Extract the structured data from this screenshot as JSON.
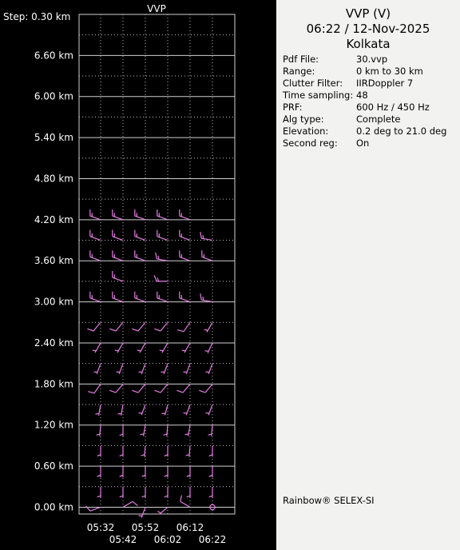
{
  "chart_data": {
    "type": "wind-barb-profile",
    "title": "VVP",
    "y_axis": {
      "step_label": "Step: 0.30 km",
      "tick_labels": [
        "0.00 km",
        "0.60 km",
        "1.20 km",
        "1.80 km",
        "2.40 km",
        "3.00 km",
        "3.60 km",
        "4.20 km",
        "4.80 km",
        "5.40 km",
        "6.00 km",
        "6.60 km"
      ],
      "ylim_km": [
        -0.1,
        7.2
      ],
      "major_tick_km": [
        0.0,
        0.6,
        1.2,
        1.8,
        2.4,
        3.0,
        3.6,
        4.2,
        4.8,
        5.4,
        6.0,
        6.6
      ],
      "minor_tick_km": [
        0.3,
        0.9,
        1.5,
        2.1,
        2.7,
        3.3,
        3.9,
        4.5,
        5.1,
        5.7,
        6.3,
        6.9
      ]
    },
    "x_axis": {
      "tick_labels_row1": [
        "05:32",
        "05:52",
        "06:12"
      ],
      "tick_labels_row2": [
        "05:42",
        "06:02",
        "06:22"
      ],
      "times": [
        "05:32",
        "05:42",
        "05:52",
        "06:02",
        "06:12",
        "06:22"
      ],
      "grid": true
    },
    "heights_km": [
      0.0,
      0.3,
      0.6,
      0.9,
      1.2,
      1.5,
      1.8,
      2.1,
      2.4,
      2.7,
      3.0,
      3.3,
      3.6,
      3.9,
      4.2
    ],
    "barb_color": "#e57ee5",
    "series": [
      {
        "time": "05:32",
        "barbs": [
          [
            250,
            10
          ],
          [
            180,
            5
          ],
          [
            180,
            5
          ],
          [
            180,
            5
          ],
          [
            185,
            5
          ],
          [
            190,
            5
          ],
          [
            215,
            10
          ],
          [
            200,
            5
          ],
          [
            210,
            5
          ],
          [
            220,
            10
          ],
          [
            290,
            15
          ],
          null,
          [
            290,
            15
          ],
          [
            290,
            15
          ],
          [
            290,
            15
          ]
        ]
      },
      {
        "time": "05:42",
        "barbs": [
          [
            60,
            10
          ],
          [
            180,
            5
          ],
          [
            180,
            5
          ],
          [
            180,
            5
          ],
          [
            180,
            5
          ],
          [
            190,
            5
          ],
          [
            220,
            10
          ],
          [
            200,
            5
          ],
          [
            210,
            5
          ],
          [
            220,
            10
          ],
          [
            290,
            15
          ],
          [
            290,
            15
          ],
          [
            290,
            15
          ],
          [
            290,
            15
          ],
          [
            290,
            15
          ]
        ]
      },
      {
        "time": "05:52",
        "barbs": [
          [
            200,
            5
          ],
          [
            180,
            5
          ],
          [
            180,
            5
          ],
          [
            185,
            5
          ],
          [
            190,
            5
          ],
          [
            200,
            5
          ],
          [
            220,
            10
          ],
          [
            200,
            5
          ],
          [
            210,
            5
          ],
          [
            220,
            10
          ],
          [
            290,
            15
          ],
          null,
          [
            290,
            15
          ],
          [
            290,
            15
          ],
          [
            290,
            15
          ]
        ]
      },
      {
        "time": "06:02",
        "barbs": [
          [
            230,
            5
          ],
          [
            180,
            5
          ],
          [
            180,
            5
          ],
          [
            180,
            5
          ],
          [
            185,
            5
          ],
          [
            195,
            5
          ],
          [
            220,
            10
          ],
          [
            200,
            5
          ],
          [
            210,
            5
          ],
          [
            220,
            10
          ],
          [
            290,
            15
          ],
          [
            270,
            15
          ],
          [
            280,
            15
          ],
          [
            290,
            15
          ],
          [
            290,
            15
          ]
        ]
      },
      {
        "time": "06:12",
        "barbs": [
          [
            300,
            10
          ],
          [
            180,
            5
          ],
          [
            180,
            5
          ],
          [
            185,
            5
          ],
          [
            190,
            5
          ],
          [
            200,
            5
          ],
          [
            220,
            10
          ],
          [
            200,
            5
          ],
          [
            210,
            5
          ],
          [
            215,
            10
          ],
          [
            290,
            15
          ],
          null,
          [
            290,
            15
          ],
          [
            290,
            15
          ],
          [
            290,
            15
          ]
        ]
      },
      {
        "time": "06:22",
        "barbs": [
          "calm",
          [
            180,
            5
          ],
          [
            180,
            5
          ],
          [
            180,
            5
          ],
          [
            185,
            5
          ],
          [
            200,
            5
          ],
          [
            220,
            10
          ],
          [
            200,
            5
          ],
          [
            205,
            5
          ],
          [
            210,
            5
          ],
          [
            280,
            15
          ],
          null,
          [
            290,
            15
          ],
          [
            280,
            15
          ],
          null
        ]
      }
    ]
  },
  "panel": {
    "title": "VVP (V)",
    "datetime": "06:22 / 12-Nov-2025",
    "location": "Kolkata",
    "rows": [
      {
        "label": "Pdf File:",
        "value": "30.vvp"
      },
      {
        "label": "Range:",
        "value": "0 km to 30 km"
      },
      {
        "label": "Clutter Filter:",
        "value": "IIRDoppler 7"
      },
      {
        "label": "Time sampling:",
        "value": "48"
      },
      {
        "label": "PRF:",
        "value": "600 Hz / 450 Hz"
      },
      {
        "label": "Alg type:",
        "value": "Complete"
      },
      {
        "label": "Elevation:",
        "value": "0.2 deg to 21.0 deg"
      },
      {
        "label": "Second reg:",
        "value": "On"
      }
    ],
    "footer": "Rainbow® SELEX-SI"
  }
}
